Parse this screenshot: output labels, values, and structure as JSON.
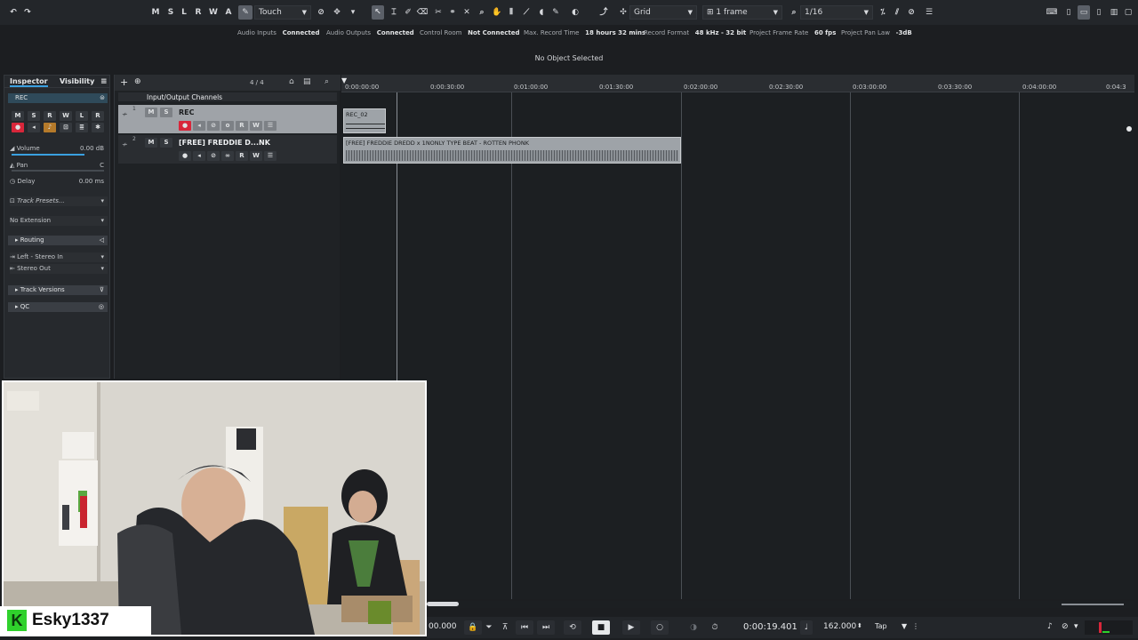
{
  "toolbar": {
    "track_buttons": [
      "M",
      "S",
      "L",
      "R",
      "W",
      "A"
    ],
    "automation_mode": "Touch",
    "grid_type": "Grid",
    "quantize_type": "1 frame",
    "quantize_value": "1/16"
  },
  "status": {
    "audio_inputs_label": "Audio Inputs",
    "audio_inputs_value": "Connected",
    "audio_outputs_label": "Audio Outputs",
    "audio_outputs_value": "Connected",
    "control_room_label": "Control Room",
    "control_room_value": "Not Connected",
    "max_record_label": "Max. Record Time",
    "max_record_value": "18 hours 32 mins",
    "record_format_label": "Record Format",
    "record_format_value": "48 kHz - 32 bit",
    "frame_rate_label": "Project Frame Rate",
    "frame_rate_value": "60 fps",
    "pan_law_label": "Project Pan Law",
    "pan_law_value": "-3dB"
  },
  "info_line": "No Object Selected",
  "inspector": {
    "tab_inspector": "Inspector",
    "tab_visibility": "Visibility",
    "track_name": "REC",
    "buttons": [
      "M",
      "S",
      "R",
      "W",
      "L",
      "R"
    ],
    "volume_label": "Volume",
    "volume_value": "0.00 dB",
    "pan_label": "Pan",
    "pan_value": "C",
    "delay_label": "Delay",
    "delay_value": "0.00 ms",
    "track_presets": "Track Presets...",
    "extension": "No Extension",
    "routing_label": "Routing",
    "routing_in": "Left - Stereo In",
    "routing_out": "Stereo Out",
    "track_versions": "Track Versions",
    "qc": "QC"
  },
  "tracklist": {
    "signature": "4 / 4",
    "folder_name": "Input/Output Channels",
    "track1_name": "REC",
    "track1_num": "1",
    "track2_name": "[FREE] FREDDIE D...NK",
    "track2_num": "2",
    "btn_m": "M",
    "btn_s": "S",
    "btn_r": "R",
    "btn_w": "W"
  },
  "ruler": {
    "ticks": [
      "0:00:00:00",
      "0:00:30:00",
      "0:01:00:00",
      "0:01:30:00",
      "0:02:00:00",
      "0:02:30:00",
      "0:03:00:00",
      "0:03:30:00",
      "0:04:00:00",
      "0:04:3"
    ]
  },
  "events": {
    "rec_event": "REC_02",
    "audio_event": "[FREE] FREDDIE DREDD x 1NONLY TYPE BEAT - ROTTEN PHONK"
  },
  "transport": {
    "left_time": "00.000",
    "position": "0:00:19.401",
    "tempo": "162.000",
    "tap": "Tap"
  },
  "webcam": {
    "username": "Esky1337",
    "logo": "K"
  }
}
